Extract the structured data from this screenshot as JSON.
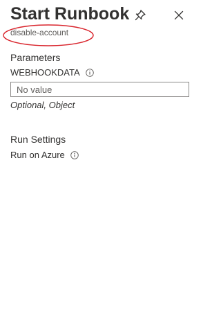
{
  "header": {
    "title": "Start Runbook",
    "subtitle": "disable-account",
    "pin_icon": "pin-icon",
    "close_icon": "close-icon",
    "annotation_color": "#d9242c"
  },
  "parameters": {
    "section_title": "Parameters",
    "webhookdata": {
      "label": "WEBHOOKDATA",
      "placeholder": "No value",
      "value": "",
      "hint": "Optional, Object"
    }
  },
  "run_settings": {
    "section_title": "Run Settings",
    "run_on_label": "Run on Azure"
  }
}
